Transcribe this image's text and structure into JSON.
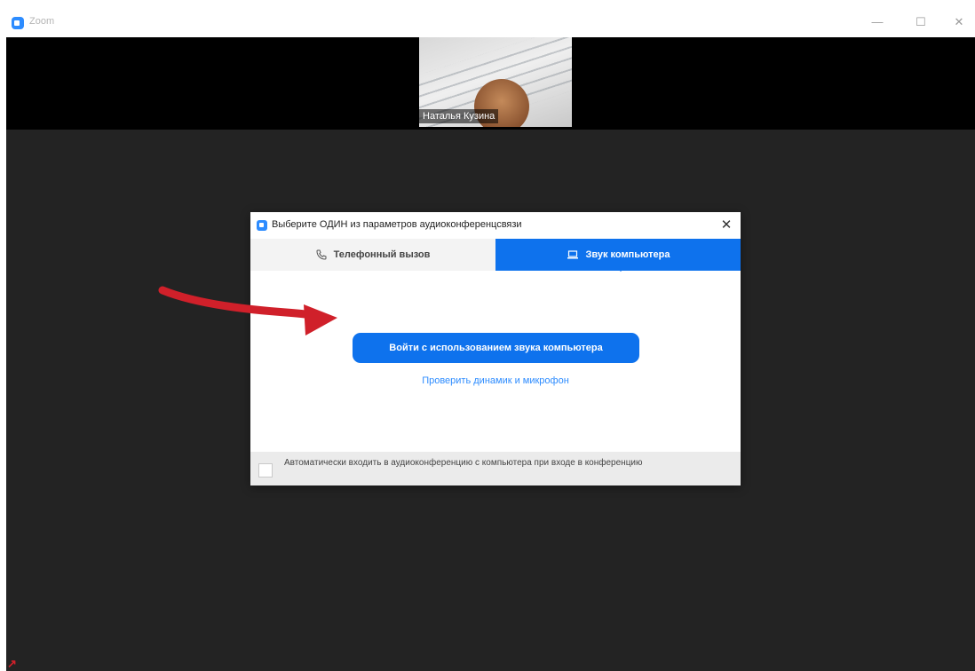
{
  "window": {
    "title": "Zoom",
    "minimize": "—",
    "maximize": "☐",
    "close": "✕"
  },
  "participant": {
    "name": "Наталья Кузина"
  },
  "dialog": {
    "title": "Выберите ОДИН из параметров аудиоконференцсвязи",
    "close": "✕",
    "tabs": [
      {
        "label": "Телефонный вызов",
        "icon": "phone-icon",
        "selected": false
      },
      {
        "label": "Звук компьютера",
        "icon": "laptop-icon",
        "selected": true
      }
    ],
    "join_button": "Войти с использованием звука компьютера",
    "test_link": "Проверить динамик и микрофон",
    "auto_join_label": "Автоматически входить в аудиоконференцию с компьютера при входе в конференцию",
    "auto_join_checked": false
  },
  "annotation": {
    "arrow_color": "#d0202a",
    "corner_mark": "↗"
  },
  "colors": {
    "accent": "#0e72ed",
    "meeting_bg": "#232323"
  }
}
